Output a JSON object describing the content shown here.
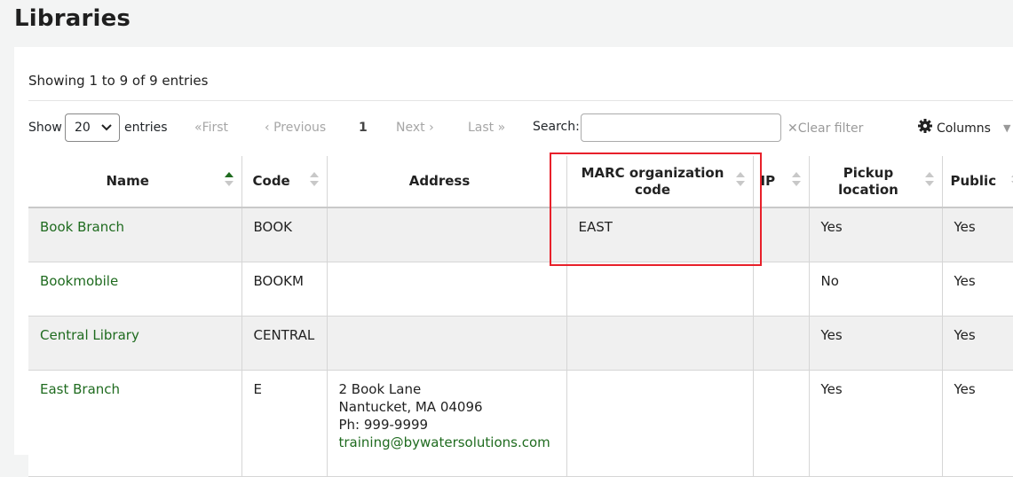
{
  "page": {
    "title": "Libraries"
  },
  "info": "Showing 1 to 9 of 9 entries",
  "length_menu": {
    "show_label": "Show",
    "selected": "20",
    "entries_label": "entries"
  },
  "pagination": {
    "first": "First",
    "previous": "Previous",
    "current_page": "1",
    "next": "Next",
    "last": "Last"
  },
  "search": {
    "label": "Search:",
    "value": "",
    "clear_filter": "Clear filter"
  },
  "columns_button": "Columns",
  "table": {
    "columns": [
      "Name",
      "Code",
      "Address",
      "MARC organization code",
      "IP",
      "Pickup location",
      "Public"
    ],
    "sorted_column": "Name",
    "rows": [
      {
        "name": "Book Branch",
        "code": "BOOK",
        "address": [],
        "email": "",
        "marc": "EAST",
        "ip": "",
        "pickup": "Yes",
        "public": "Yes"
      },
      {
        "name": "Bookmobile",
        "code": "BOOKM",
        "address": [],
        "email": "",
        "marc": "",
        "ip": "",
        "pickup": "No",
        "public": "Yes"
      },
      {
        "name": "Central Library",
        "code": "CENTRAL",
        "address": [],
        "email": "",
        "marc": "",
        "ip": "",
        "pickup": "Yes",
        "public": "Yes"
      },
      {
        "name": "East Branch",
        "code": "E",
        "address": [
          "2 Book Lane",
          "Nantucket, MA 04096",
          "Ph: 999-9999"
        ],
        "email": "training@bywatersolutions.com",
        "marc": "",
        "ip": "",
        "pickup": "Yes",
        "public": "Yes"
      }
    ]
  },
  "colors": {
    "link": "#1f6b1f",
    "highlight_border": "#e8202a"
  },
  "icons": [
    "first-double-chevron-icon",
    "previous-chevron-icon",
    "next-chevron-icon",
    "last-double-chevron-icon",
    "clear-x-icon",
    "gear-icon",
    "sort-arrows-icon"
  ]
}
